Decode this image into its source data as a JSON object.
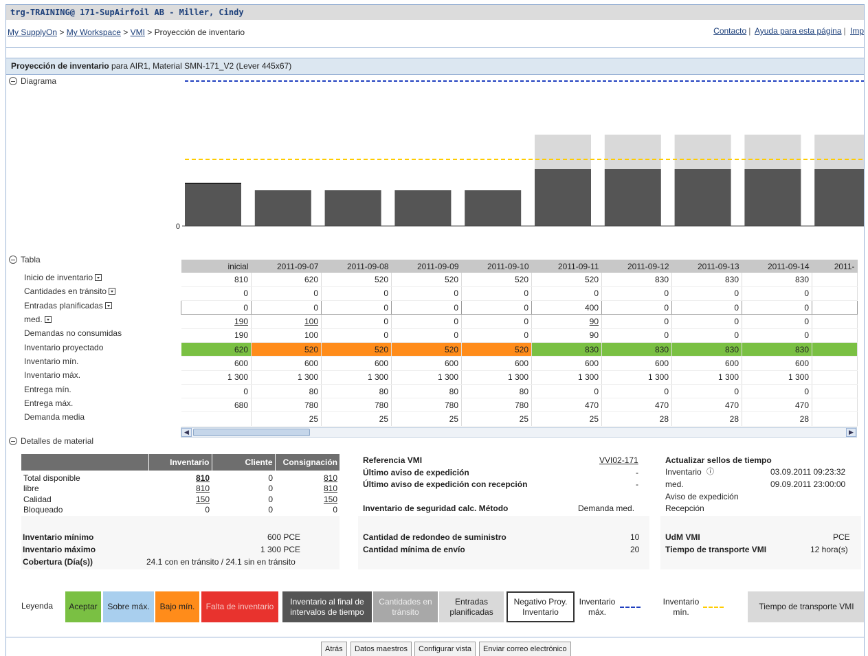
{
  "window_title": "trg-TRAINING@ 171-SupAirfoil AB - Miller, Cindy",
  "breadcrumb": {
    "items": [
      "My SupplyOn",
      "My Workspace",
      "VMI"
    ],
    "sep": ">",
    "current": "Proyección de inventario"
  },
  "top_links": {
    "contact": "Contacto",
    "help": "Ayuda para esta página",
    "print": "Impr"
  },
  "section_header": {
    "title": "Proyección de inventario",
    "rest": " para AIR1, Material SMN-171_V2 (Lever 445x67)"
  },
  "sections": {
    "diagram": "Diagrama",
    "table": "Tabla",
    "details": "Detalles de material"
  },
  "chart_data": {
    "type": "bar",
    "categories": [
      "inicial",
      "2011-09-07",
      "2011-09-08",
      "2011-09-09",
      "2011-09-10",
      "2011-09-11",
      "2011-09-12",
      "2011-09-13",
      "2011-09-14",
      "2011-"
    ],
    "series": [
      {
        "role": "projected_inventory",
        "values": [
          620,
          520,
          520,
          520,
          520,
          830,
          830,
          830,
          830,
          830
        ]
      },
      {
        "role": "planned_receipts",
        "values": [
          0,
          0,
          0,
          0,
          0,
          400,
          0,
          0,
          0,
          0
        ]
      }
    ],
    "inventario_min": 600,
    "inventario_max": 1300,
    "y_tick_label": "0",
    "colors": {
      "inventory": "#555555",
      "receipts": "#d9d9d9",
      "min_line": "#ffcc00",
      "max_line": "#1f3fbf"
    }
  },
  "table": {
    "columns": [
      "inicial",
      "2011-09-07",
      "2011-09-08",
      "2011-09-09",
      "2011-09-10",
      "2011-09-11",
      "2011-09-12",
      "2011-09-13",
      "2011-09-14",
      "2011-"
    ],
    "rows": [
      {
        "label": "Inicio de inventario",
        "dropdown": true,
        "values": [
          "810",
          "620",
          "520",
          "520",
          "520",
          "520",
          "830",
          "830",
          "830",
          ""
        ]
      },
      {
        "label": "Cantidades en tránsito",
        "dropdown": true,
        "values": [
          "0",
          "0",
          "0",
          "0",
          "0",
          "0",
          "0",
          "0",
          "0",
          ""
        ]
      },
      {
        "label": "Entradas planificadas",
        "dropdown": true,
        "values": [
          "0",
          "0",
          "0",
          "0",
          "0",
          "400",
          "0",
          "0",
          "0",
          ""
        ],
        "boxed": true
      },
      {
        "label": "med.",
        "dropdown": true,
        "values": [
          "190",
          "100",
          "0",
          "0",
          "0",
          "90",
          "0",
          "0",
          "0",
          ""
        ],
        "links": [
          0,
          1,
          5
        ]
      },
      {
        "label": "Demandas no consumidas",
        "values": [
          "190",
          "100",
          "0",
          "0",
          "0",
          "90",
          "0",
          "0",
          "0",
          ""
        ]
      },
      {
        "label": "Inventario proyectado",
        "values": [
          "620",
          "520",
          "520",
          "520",
          "520",
          "830",
          "830",
          "830",
          "830",
          ""
        ],
        "colors": [
          "green",
          "orange",
          "orange",
          "orange",
          "orange",
          "green",
          "green",
          "green",
          "green",
          "green"
        ]
      },
      {
        "label": "Inventario mín.",
        "values": [
          "600",
          "600",
          "600",
          "600",
          "600",
          "600",
          "600",
          "600",
          "600",
          ""
        ]
      },
      {
        "label": "Inventario máx.",
        "values": [
          "1 300",
          "1 300",
          "1 300",
          "1 300",
          "1 300",
          "1 300",
          "1 300",
          "1 300",
          "1 300",
          ""
        ]
      },
      {
        "label": "Entrega mín.",
        "values": [
          "0",
          "80",
          "80",
          "80",
          "80",
          "0",
          "0",
          "0",
          "0",
          ""
        ]
      },
      {
        "label": "Entrega máx.",
        "values": [
          "680",
          "780",
          "780",
          "780",
          "780",
          "470",
          "470",
          "470",
          "470",
          ""
        ]
      },
      {
        "label": "Demanda media",
        "values": [
          "",
          "25",
          "25",
          "25",
          "25",
          "25",
          "28",
          "28",
          "28",
          ""
        ]
      }
    ]
  },
  "material": {
    "headers": [
      "Inventario",
      "Cliente",
      "Consignación"
    ],
    "rows": [
      {
        "label": "Total disponible",
        "values": [
          "810",
          "0",
          "810"
        ]
      },
      {
        "label": "libre",
        "values": [
          "810",
          "0",
          "810"
        ]
      },
      {
        "label": "Calidad",
        "values": [
          "150",
          "0",
          "150"
        ]
      },
      {
        "label": "Bloqueado",
        "values": [
          "0",
          "0",
          "0"
        ]
      }
    ],
    "min_inv_label": "Inventario mínimo",
    "min_inv_value": "600 PCE",
    "max_inv_label": "Inventario máximo",
    "max_inv_value": "1 300 PCE",
    "coverage_label": "Cobertura (Día(s))",
    "coverage_value": "24.1 con en tránsito / 24.1 sin en tránsito",
    "vmi_ref_label": "Referencia VMI",
    "vmi_ref_value": "VVI02-171",
    "last_asn_label": "Último aviso de expedición",
    "last_asn_value": "-",
    "last_asn_recv_label": "Último aviso de expedición con recepción",
    "last_asn_recv_value": "-",
    "safety_label": "Inventario de seguridad calc. Método",
    "safety_value": "Demanda med.",
    "rounding_label": "Cantidad de redondeo de suministro",
    "rounding_value": "10",
    "min_ship_label": "Cantidad mínima de envío",
    "min_ship_value": "20",
    "timestamps_title": "Actualizar sellos de tiempo",
    "ts_inventory_label": "Inventario",
    "ts_inventory_value": "03.09.2011 09:23:32",
    "ts_med_label": "med.",
    "ts_med_value": "09.09.2011 23:00:00",
    "ts_asn_label": "Aviso de expedición",
    "ts_receipt_label": "Recepción",
    "uom_label": "UdM VMI",
    "uom_value": "PCE",
    "transport_label": "Tiempo de transporte VMI",
    "transport_value": "12 hora(s)"
  },
  "legend": {
    "title": "Leyenda",
    "accept": "Aceptar",
    "over_max": "Sobre máx.",
    "under_min": "Bajo mín.",
    "stockout": "Falta de inventario",
    "end_inventory": "Inventario al final de intervalos de tiempo",
    "in_transit": "Cantidades en tránsito",
    "planned": "Entradas planificadas",
    "negative": "Negativo Proy. Inventario",
    "inv_max": "Inventario máx.",
    "inv_min": "Inventario mín.",
    "transport": "Tiempo de transporte VMI"
  },
  "buttons": {
    "back": "Atrás",
    "master": "Datos maestros",
    "config": "Configurar vista",
    "email": "Enviar correo electrónico"
  }
}
